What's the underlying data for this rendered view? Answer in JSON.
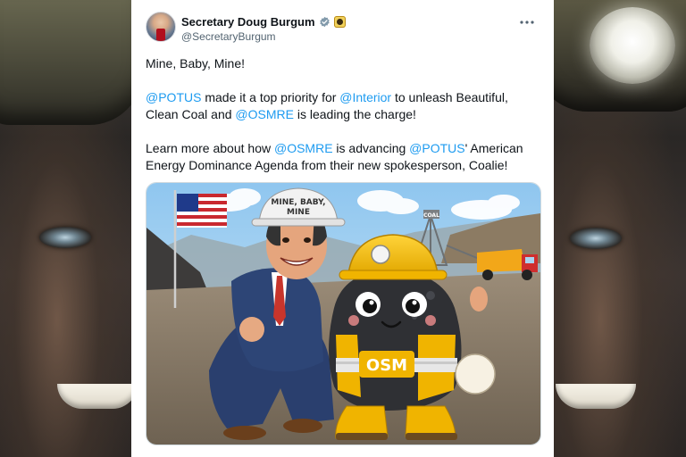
{
  "tweet": {
    "author": {
      "display_name": "Secretary Doug Burgum",
      "handle": "@SecretaryBurgum",
      "verified": true,
      "avatar_icon": "avatar-photo",
      "affiliation_icon": "department-seal-icon"
    },
    "more_icon": "more-options-icon",
    "paragraphs": {
      "p1": {
        "text": "Mine, Baby, Mine!"
      },
      "p2": {
        "m1": "@POTUS",
        "t1": " made it a top priority for ",
        "m2": "@Interior",
        "t2": " to unleash Beautiful, Clean Coal and ",
        "m3": "@OSMRE",
        "t3": " is leading the charge!"
      },
      "p3": {
        "t1": "Learn more about how ",
        "m1": "@OSMRE",
        "t2": " is advancing ",
        "m2": "@POTUS",
        "t3": "' American Energy Dominance Agenda from their new spokesperson, Coalie!"
      }
    },
    "media": {
      "helmet_text_line1": "MINE, BABY,",
      "helmet_text_line2": "MINE",
      "vest_text": "OSM",
      "silo_text": "COAL"
    }
  },
  "colors": {
    "link": "#1d9bf0",
    "text": "#0f1419",
    "secondary": "#536471",
    "verified": "#829aab",
    "card_bg": "#ffffff"
  }
}
